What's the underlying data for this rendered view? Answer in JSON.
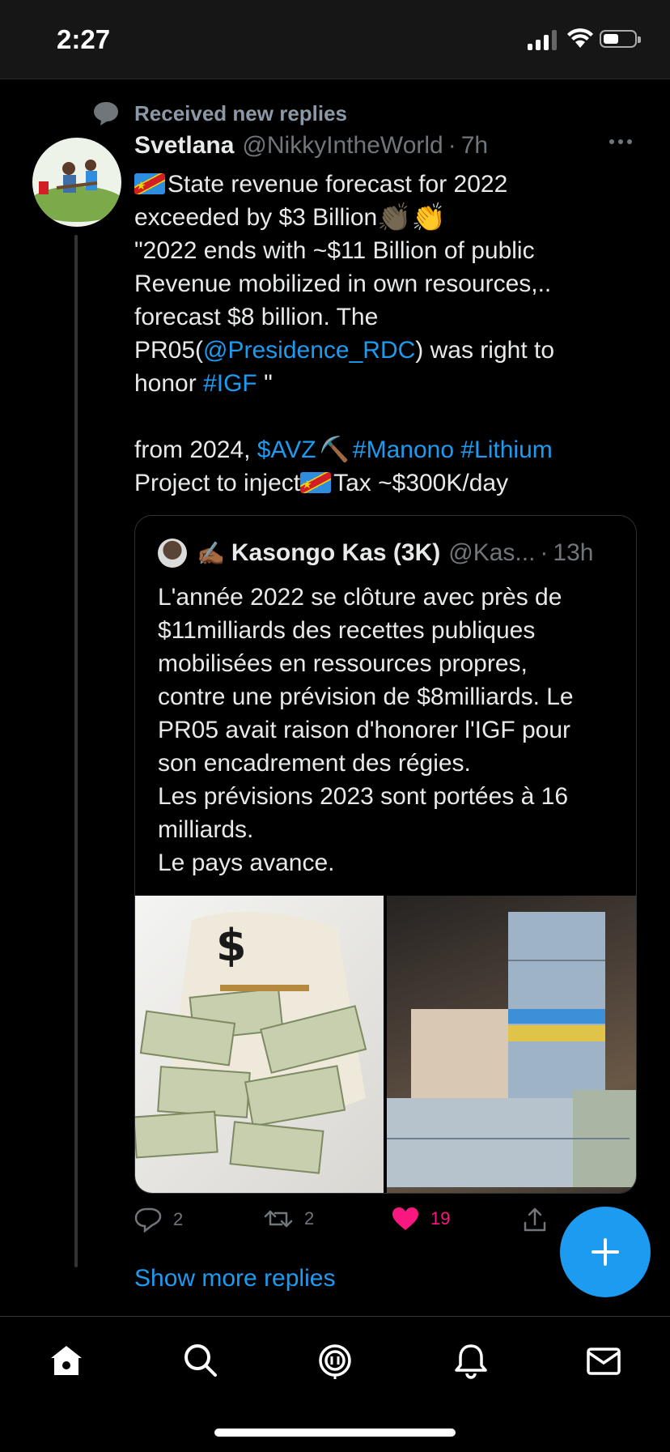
{
  "status_bar": {
    "time": "2:27"
  },
  "context": {
    "label": "Received new replies"
  },
  "tweet": {
    "author_name": "Svetlana",
    "handle": "@NikkyIntheWorld",
    "separator": "·",
    "age": "7h",
    "lines": {
      "l1": "State revenue forecast for 2022",
      "l2": "exceeded by $3 Billion",
      "l3": "\"2022 ends with ~$11 Billion of public",
      "l4": "Revenue mobilized in own resources,..",
      "l5": "forecast $8 billion. The",
      "l6_a": "PR05(",
      "l6_link": "@Presidence_RDC",
      "l6_b": ") was right to",
      "l7_a": "honor ",
      "l7_link": "#IGF",
      "l7_b": " \"",
      "l8_a": "from 2024, ",
      "l8_link1": "$AVZ",
      "l8_pick": "⛏️",
      "l8_link2": "#Manono",
      "l8_link3": "#Lithium",
      "l9_a": "Project to inject",
      "l9_b": "Tax ~$300K/day"
    }
  },
  "quote": {
    "emoji": "✍🏾",
    "author_name": "Kasongo Kas (3K)",
    "handle": "@Kas...",
    "separator": "·",
    "age": "13h",
    "lines": [
      "L'année 2022 se clôture avec près de",
      "$11milliards des recettes publiques",
      "mobilisées en ressources propres,",
      "contre une prévision de $8milliards. Le",
      "PR05 avait raison d'honorer l'IGF pour",
      "son encadrement des régies.",
      "Les prévisions 2023 sont portées à 16",
      "milliards.",
      "Le pays avance."
    ]
  },
  "actions": {
    "replies": "2",
    "retweets": "2",
    "likes": "19"
  },
  "show_more": "Show more replies",
  "colors": {
    "accent": "#1d9bf0",
    "like": "#f91880",
    "muted": "#71767b"
  },
  "icons": [
    "reply-icon",
    "retweet-icon",
    "heart-icon",
    "share-icon",
    "home-icon",
    "search-icon",
    "spaces-icon",
    "bell-icon",
    "mail-icon"
  ]
}
